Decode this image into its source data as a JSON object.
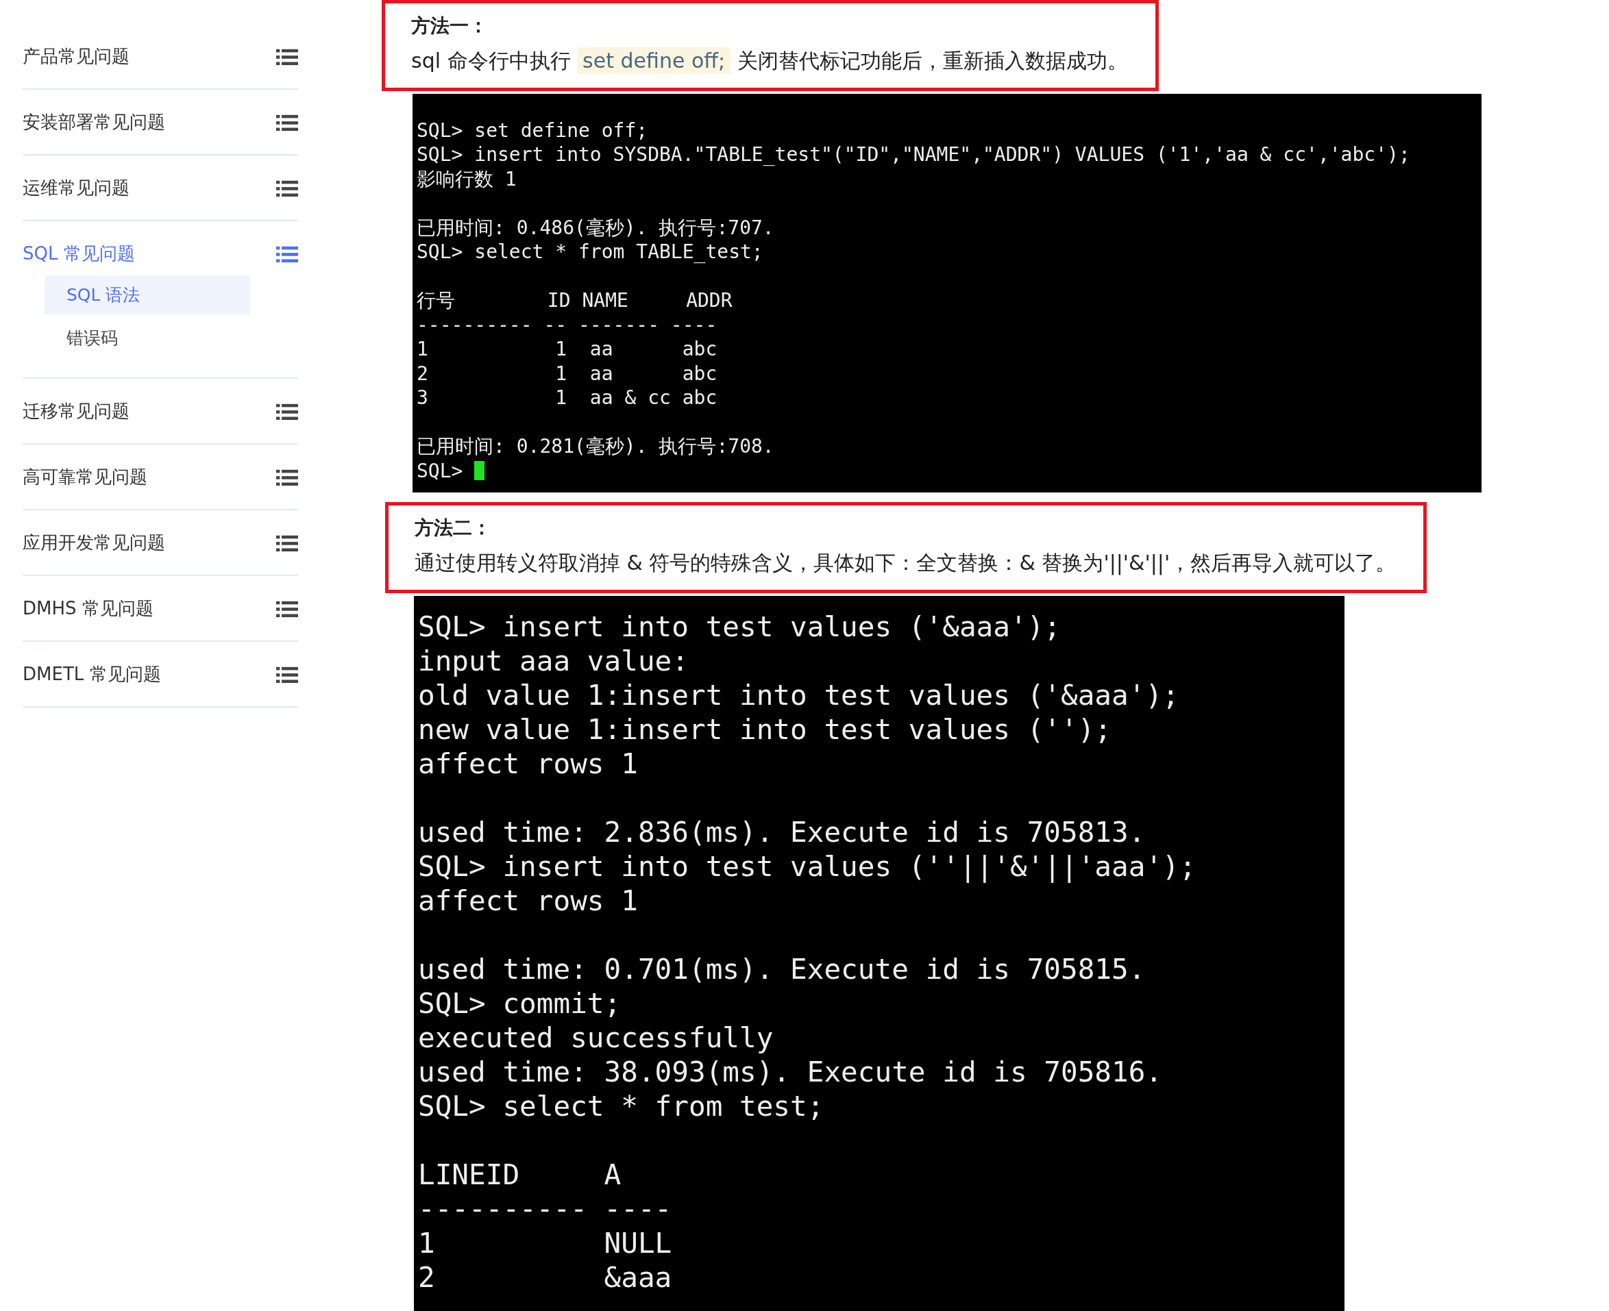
{
  "sidebar": {
    "items": [
      {
        "label": "产品常见问题",
        "selected": false
      },
      {
        "label": "安装部署常见问题",
        "selected": false
      },
      {
        "label": "运维常见问题",
        "selected": false
      },
      {
        "label": "SQL 常见问题",
        "selected": true,
        "children": [
          {
            "label": "SQL 语法",
            "selected": true
          },
          {
            "label": "错误码",
            "selected": false
          }
        ]
      },
      {
        "label": "迁移常见问题",
        "selected": false
      },
      {
        "label": "高可靠常见问题",
        "selected": false
      },
      {
        "label": "应用开发常见问题",
        "selected": false
      },
      {
        "label": "DMHS 常见问题",
        "selected": false
      },
      {
        "label": "DMETL 常见问题",
        "selected": false
      }
    ]
  },
  "sections": [
    {
      "title": "方法一：",
      "parts": [
        {
          "kind": "text",
          "text": "sql 命令行中执行 "
        },
        {
          "kind": "code",
          "text": "set define off;"
        },
        {
          "kind": "text",
          "text": " 关闭替代标记功能后，重新插入数据成功。"
        }
      ],
      "terminal": {
        "blocks": [
          [
            "SQL> set define off;",
            "SQL> insert into SYSDBA.\"TABLE_test\"(\"ID\",\"NAME\",\"ADDR\") VALUES ('1','aa & cc','abc');",
            "影响行数 1"
          ],
          [
            "已用时间: 0.486(毫秒). 执行号:707.",
            "SQL> select * from TABLE_test;"
          ],
          [
            "行号        ID NAME     ADDR",
            "---------- -- ------- ----",
            "1           1  aa      abc",
            "2           1  aa      abc",
            "3           1  aa & cc abc"
          ],
          [
            "已用时间: 0.281(毫秒). 执行号:708.",
            "SQL> "
          ]
        ]
      }
    },
    {
      "title": "方法二：",
      "parts": [
        {
          "kind": "text",
          "text": "通过使用转义符取消掉 & 符号的特殊含义，具体如下：全文替换：& 替换为'||'&'||'，然后再导入就可以了。"
        }
      ],
      "terminal": {
        "blocks": [
          [
            "SQL> insert into test values ('&aaa');",
            "input aaa value:",
            "old value 1:insert into test values ('&aaa');",
            "new value 1:insert into test values ('');",
            "affect rows 1"
          ],
          [
            "used time: 2.836(ms). Execute id is 705813.",
            "SQL> insert into test values (''||'&'||'aaa');",
            "affect rows 1"
          ],
          [
            "used time: 0.701(ms). Execute id is 705815.",
            "SQL> commit;",
            "executed successfully",
            "used time: 38.093(ms). Execute id is 705816.",
            "SQL> select * from test;"
          ],
          [
            "LINEID     A",
            "---------- ----",
            "1          NULL",
            "2          &aaa"
          ]
        ]
      }
    }
  ]
}
